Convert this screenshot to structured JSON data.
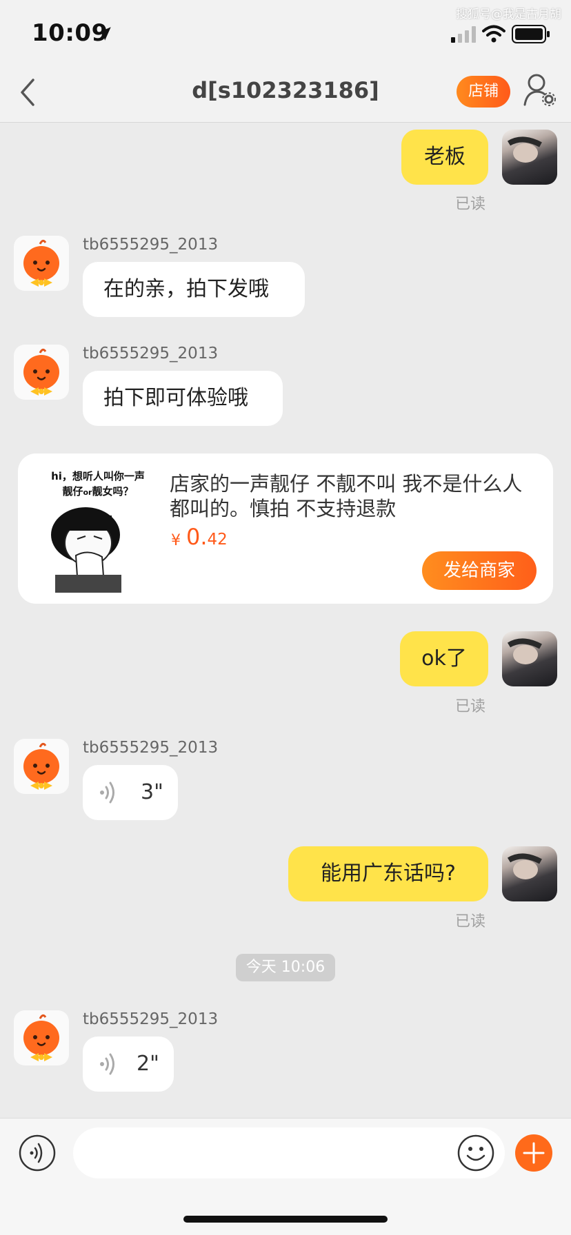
{
  "status_bar": {
    "time": "10:09",
    "watermark": "搜狐号@我是古月胡"
  },
  "header": {
    "title": "d[s102323186]",
    "shop_label": "店铺"
  },
  "messages": {
    "m1": {
      "text": "老板",
      "read": "已读"
    },
    "m2": {
      "sender": "tb6555295_2013",
      "text": "在的亲，拍下发哦"
    },
    "m3": {
      "sender": "tb6555295_2013",
      "text": "拍下即可体验哦"
    },
    "product": {
      "image_caption_line1": "hi，想听人叫你一声",
      "image_caption_line2a": "靓仔",
      "image_caption_or": "or",
      "image_caption_line2b": "靓女吗？",
      "description": "店家的一声靓仔 不靓不叫 我不是什么人都叫的。慎拍 不支持退款",
      "price_symbol": "¥",
      "price_main": "0.",
      "price_decimal": "42",
      "send_label": "发给商家"
    },
    "m5": {
      "text": "ok了",
      "read": "已读"
    },
    "m6": {
      "sender": "tb6555295_2013",
      "duration": "3\""
    },
    "m7": {
      "text": "能用广东话吗?",
      "read": "已读"
    },
    "timestamp": "今天 10:06",
    "m8": {
      "sender": "tb6555295_2013",
      "duration": "2\""
    }
  },
  "input": {
    "placeholder": ""
  },
  "colors": {
    "accent_orange": "#ff6a1a",
    "bubble_yellow": "#ffe34a",
    "background": "#ebebeb"
  },
  "icons": [
    "back-icon",
    "profile-settings-icon",
    "voice-icon",
    "emoji-icon",
    "plus-icon",
    "location-arrow-icon",
    "signal-icon",
    "wifi-icon",
    "battery-icon"
  ]
}
